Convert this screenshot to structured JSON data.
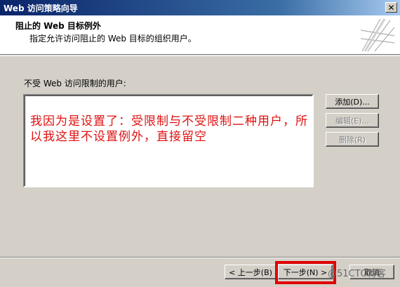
{
  "window": {
    "title": "Web 访问策略向导",
    "close_glyph": "✕"
  },
  "header": {
    "title": "阻止的 Web 目标例外",
    "subtitle": "指定允许访问阻止的 Web 目标的组织用户。"
  },
  "main": {
    "list_label": "不受 Web 访问限制的用户:",
    "annotation": "我因为是设置了：受限制与不受限制二种用户，所以我这里不设置例外，直接留空"
  },
  "buttons": {
    "add": "添加(D)...",
    "edit": "编辑(E)...",
    "delete": "删除(R)",
    "back": "< 上一步(B)",
    "next": "下一步(N) >",
    "cancel": "取消"
  },
  "watermark": "@51CTO博客",
  "colors": {
    "annotation": "#e01010",
    "highlight": "#e00000",
    "titlebar_start": "#0a246a"
  }
}
